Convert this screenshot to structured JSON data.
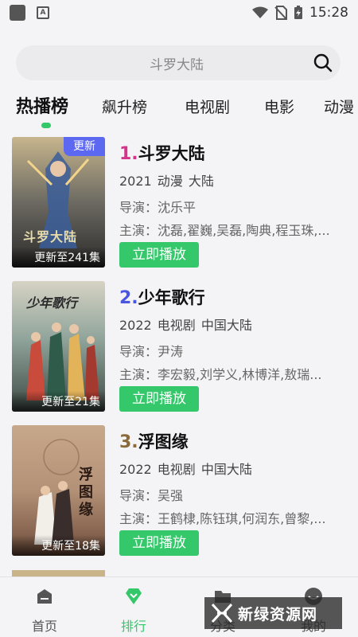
{
  "status_bar": {
    "time": "15:28"
  },
  "search": {
    "placeholder": "斗罗大陆"
  },
  "tabs": [
    {
      "label": "热播榜",
      "active": true
    },
    {
      "label": "飙升榜",
      "active": false
    },
    {
      "label": "电视剧",
      "active": false
    },
    {
      "label": "电影",
      "active": false
    },
    {
      "label": "动漫",
      "active": false
    }
  ],
  "items": [
    {
      "rank": "1.",
      "rank_color": "#d6338a",
      "title": "斗罗大陆",
      "badge": "更新",
      "episode": "更新至241集",
      "meta": "2021 动漫 大陆",
      "director": "导演：沈乐平",
      "cast": "主演：沈磊,翟巍,吴磊,陶典,程玉珠,...",
      "button": "立即播放",
      "poster_text": "斗罗大陆"
    },
    {
      "rank": "2.",
      "rank_color": "#4a55e0",
      "title": "少年歌行",
      "episode": "更新至21集",
      "meta": "2022 电视剧 中国大陆",
      "director": "导演：尹涛",
      "cast": "主演：李宏毅,刘学义,林博洋,敖瑞...",
      "button": "立即播放",
      "poster_text": "少年歌行"
    },
    {
      "rank": "3.",
      "rank_color": "#8a6a3a",
      "title": "浮图缘",
      "episode": "更新至18集",
      "meta": "2022 电视剧 中国大陆",
      "director": "导演：吴强",
      "cast": "主演：王鹤棣,陈钰琪,何润东,曾黎,...",
      "button": "立即播放",
      "poster_text": "浮图缘"
    }
  ],
  "nav": [
    {
      "label": "首页",
      "icon": "home-icon"
    },
    {
      "label": "排行",
      "icon": "rank-icon",
      "active": true
    },
    {
      "label": "分类",
      "icon": "folder-icon"
    },
    {
      "label": "我的",
      "icon": "user-icon"
    }
  ],
  "watermark": {
    "text": "新绿资源网"
  },
  "colors": {
    "accent": "#35c86a",
    "badge": "#5d68f0"
  }
}
